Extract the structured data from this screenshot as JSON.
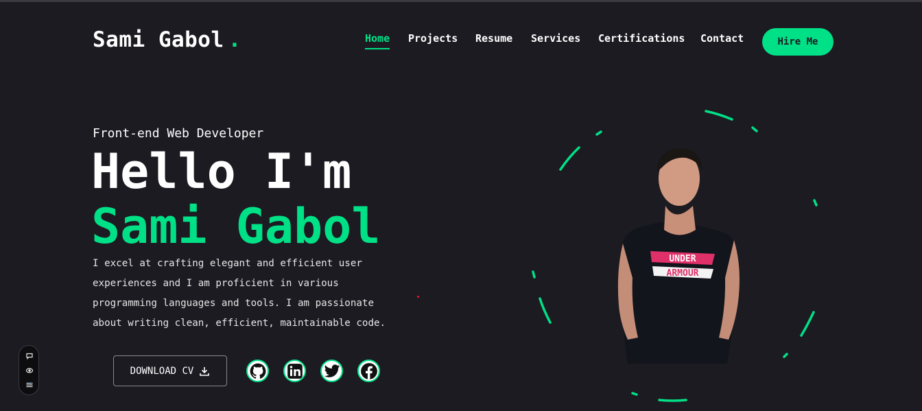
{
  "brand": {
    "name": "Sami Gabol",
    "dot": ".",
    "accent": "#00e187",
    "background": "#1c1b22"
  },
  "nav": {
    "items": [
      {
        "label": "Home",
        "active": true
      },
      {
        "label": "Projects",
        "active": false
      },
      {
        "label": "Resume",
        "active": false
      },
      {
        "label": "Services",
        "active": false
      },
      {
        "label": "Certifications",
        "active": false
      },
      {
        "label": "Contact",
        "active": false
      }
    ],
    "hire_label": "Hire Me"
  },
  "hero": {
    "role": "Front-end Web Developer",
    "greeting": "Hello I'm",
    "name": "Sami Gabol",
    "description": "I excel at crafting elegant and efficient user experiences and I am proficient in various programming languages and tools. I am passionate about writing clean, efficient, maintainable code.",
    "download_label": "DOWNLOAD CV",
    "download_icon": "download-icon"
  },
  "social": [
    {
      "name": "github",
      "icon": "github-icon"
    },
    {
      "name": "linkedin",
      "icon": "linkedin-icon"
    },
    {
      "name": "twitter",
      "icon": "twitter-icon"
    },
    {
      "name": "facebook",
      "icon": "facebook-icon"
    }
  ],
  "side_widget": {
    "icons": [
      "chat-icon",
      "eye-icon",
      "settings-icon"
    ]
  },
  "portrait": {
    "shirt_text_line1": "UNDER",
    "shirt_text_line2": "ARMOUR"
  }
}
